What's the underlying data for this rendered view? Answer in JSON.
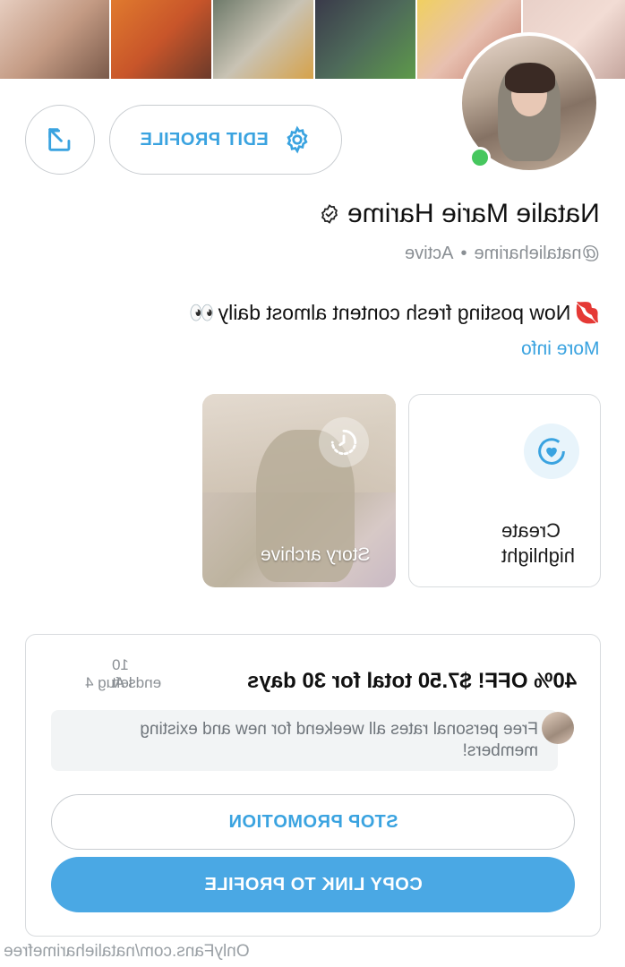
{
  "profile": {
    "name": "Natalie Marie Harime",
    "handle": "@natalieharime",
    "status": "Active",
    "bio": "Now posting fresh content almost daily",
    "bio_emoji_start": "💋",
    "bio_emoji_end": "👀",
    "more_info": "More info",
    "edit_label": "EDIT PROFILE"
  },
  "highlights": {
    "create_line1": "Create",
    "create_line2": "highlight",
    "archive_label": "Story archive"
  },
  "promo": {
    "title": "40% OFF! $7.50 total for 30 days",
    "left": "10 left",
    "ends": "ends Aug 4",
    "message": "Free personal rates all weekend for new and existing members!",
    "stop_label": "STOP PROMOTION",
    "copy_label": "COPY LINK TO PROFILE"
  },
  "footer": {
    "watermark": "OnlyFans.com/natalieharimefree"
  },
  "colors": {
    "accent": "#3aa3e0",
    "online": "#46c75e",
    "primary_button": "#4aa8e4"
  },
  "icons": {
    "share": "share-arrow-icon",
    "settings": "gear-icon",
    "verified": "verified-badge-icon",
    "create_highlight": "heart-circle-icon",
    "archive": "clock-history-icon"
  }
}
